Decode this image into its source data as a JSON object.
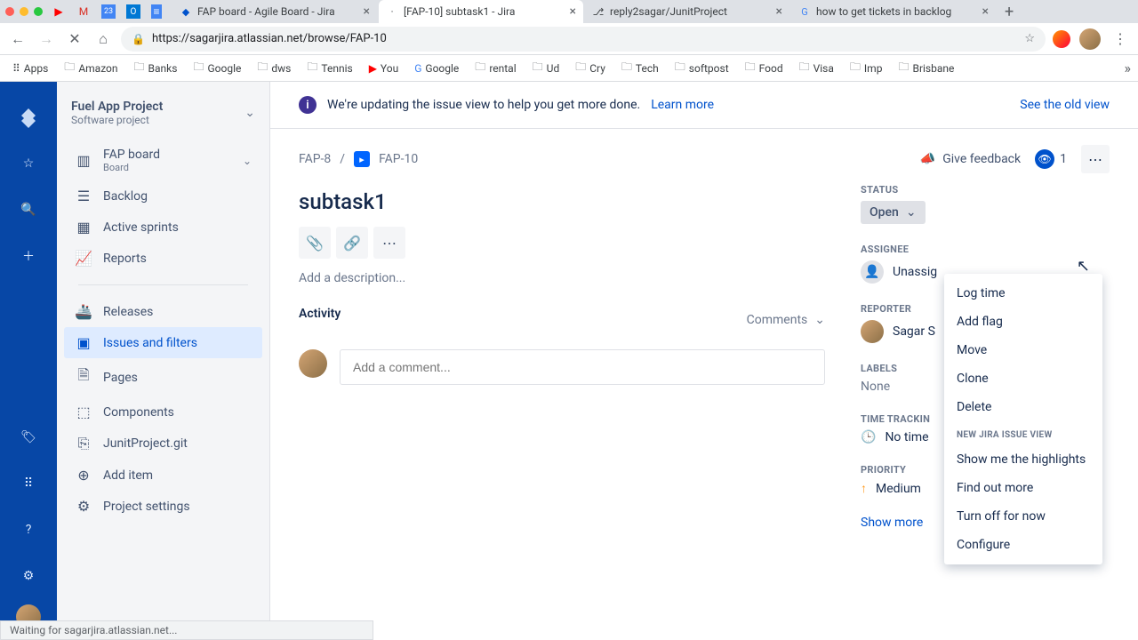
{
  "browser": {
    "tabs": [
      {
        "title": "FAP board - Agile Board - Jira"
      },
      {
        "title": "[FAP-10] subtask1 - Jira"
      },
      {
        "title": "reply2sagar/JunitProject"
      },
      {
        "title": "how to get tickets in backlog"
      }
    ],
    "url_display": "https://sagarjira.atlassian.net/browse/FAP-10",
    "bookmarks": [
      "Apps",
      "Amazon",
      "Banks",
      "Google",
      "dws",
      "Tennis",
      "You",
      "Google",
      "rental",
      "Ud",
      "Cry",
      "Tech",
      "softpost",
      "Food",
      "Visa",
      "Imp",
      "Brisbane"
    ],
    "status": "Waiting for sagarjira.atlassian.net..."
  },
  "project": {
    "name": "Fuel App Project",
    "subtitle": "Software project"
  },
  "sidebar": {
    "board_name": "FAP board",
    "board_sub": "Board",
    "items": {
      "backlog": "Backlog",
      "sprints": "Active sprints",
      "reports": "Reports",
      "releases": "Releases",
      "issues": "Issues and filters",
      "pages": "Pages",
      "components": "Components",
      "junit": "JunitProject.git",
      "additem": "Add item",
      "settings": "Project settings"
    }
  },
  "banner": {
    "msg": "We're updating the issue view to help you get more done.",
    "learn": "Learn more",
    "oldview": "See the old view"
  },
  "breadcrumb": {
    "parent": "FAP-8",
    "separator": "/",
    "current": "FAP-10"
  },
  "toolbar": {
    "feedback": "Give feedback",
    "watchers": "1"
  },
  "issue": {
    "title": "subtask1",
    "desc_placeholder": "Add a description...",
    "activity_heading": "Activity",
    "activity_filter": "Comments",
    "comment_placeholder": "Add a comment..."
  },
  "fields": {
    "status_label": "STATUS",
    "status_value": "Open",
    "assignee_label": "ASSIGNEE",
    "assignee_value": "Unassig",
    "reporter_label": "REPORTER",
    "reporter_value": "Sagar S",
    "labels_label": "LABELS",
    "labels_value": "None",
    "timetracking_label": "TIME TRACKIN",
    "timetracking_value": "No time",
    "priority_label": "PRIORITY",
    "priority_value": "Medium",
    "show_more": "Show more"
  },
  "menu": {
    "items": [
      "Log time",
      "Add flag",
      "Move",
      "Clone",
      "Delete"
    ],
    "section_label": "NEW JIRA ISSUE VIEW",
    "section_items": [
      "Show me the highlights",
      "Find out more",
      "Turn off for now"
    ],
    "configure": "Configure"
  }
}
